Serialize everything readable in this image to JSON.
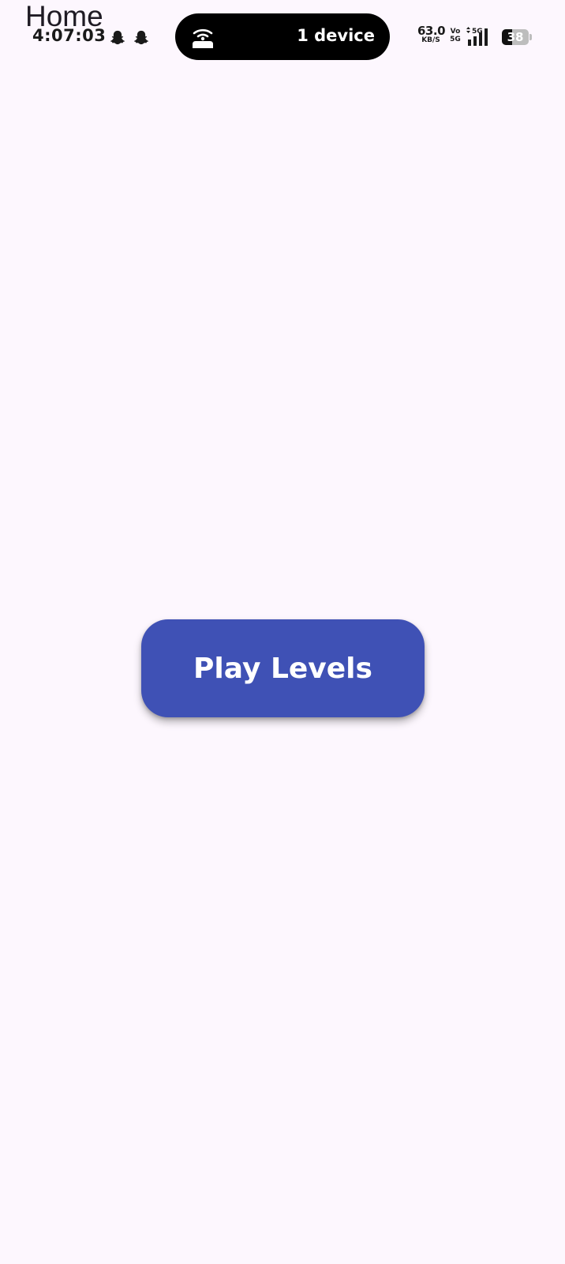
{
  "status_bar": {
    "time": "4:07:03",
    "notification_icons": [
      "snapchat-icon",
      "snapchat-icon"
    ],
    "hotspot": {
      "icon": "hotspot-icon",
      "label": "1 device"
    },
    "net_speed": {
      "value": "63.0",
      "unit": "KB/S"
    },
    "volte": {
      "top": "Vo",
      "bottom": "5G"
    },
    "network_type": "5G",
    "signal_icon": "signal-strength-icon",
    "battery": {
      "level": "38",
      "level_fraction": 0.38
    }
  },
  "header": {
    "title": "Home"
  },
  "main": {
    "play_button_label": "Play Levels",
    "button_color": "#3f51b5"
  },
  "colors": {
    "background": "#fdf7fe",
    "text": "#1f1b24"
  }
}
